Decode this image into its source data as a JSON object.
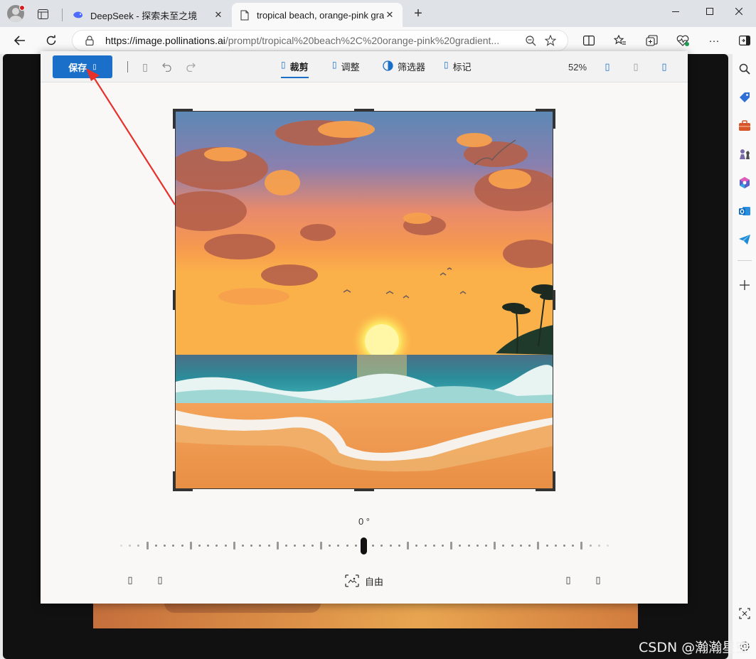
{
  "browser": {
    "tabs": [
      {
        "title": "DeepSeek - 探索未至之境",
        "active": false,
        "favicon": "deepseek-whale-icon"
      },
      {
        "title": "tropical beach, orange-pink gradient",
        "active": true,
        "favicon": "page-icon"
      }
    ],
    "new_tab_symbol": "+",
    "close_symbol": "✕",
    "window_controls": {
      "minimize": "—",
      "maximize": "☐",
      "close": "✕"
    },
    "address": {
      "url_host": "https://image.pollinations.ai",
      "url_rest": "/prompt/tropical%20beach%2C%20orange-pink%20gradient..."
    },
    "more_symbol": "···"
  },
  "editor": {
    "save_label": "保存",
    "save_caret": "▯",
    "divider": "|",
    "modes": [
      {
        "label": "裁剪",
        "icon": "crop-icon",
        "active": true
      },
      {
        "label": "调整",
        "icon": "adjust-icon",
        "active": false
      },
      {
        "label": "筛选器",
        "icon": "filter-icon",
        "active": false
      },
      {
        "label": "标记",
        "icon": "markup-icon",
        "active": false
      }
    ],
    "zoom": "52%",
    "rotation_value": "0 °",
    "rotation_level": 0,
    "aspect_label": "自由",
    "placeholder_glyph": "▯"
  },
  "watermark": "CSDN @瀚瀚星空",
  "colors": {
    "accent": "#1a6fc8",
    "annotation_arrow": "#e8302a",
    "backdrop": "#111111"
  }
}
